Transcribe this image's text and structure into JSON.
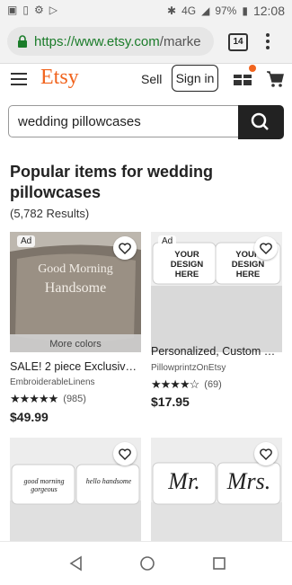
{
  "status": {
    "time": "12:08",
    "battery": "97%",
    "network": "4G"
  },
  "browser": {
    "url_secure": "https://",
    "url_host": "www.etsy.com",
    "url_rest": "/marke",
    "tab_count": "14"
  },
  "header": {
    "logo": "Etsy",
    "sell": "Sell",
    "sign_in": "Sign in"
  },
  "search": {
    "query": "wedding pillowcases"
  },
  "results": {
    "title": "Popular items for wedding pillowcases",
    "count": "(5,782 Results)"
  },
  "products": [
    {
      "ad": "Ad",
      "image_text_1": "Good Morning",
      "image_text_2": "Handsome",
      "more_colors": "More colors",
      "title": "SALE! 2 piece Exclusive ...",
      "shop": "EmbroiderableLinens",
      "rating": 5,
      "reviews": "(985)",
      "price": "$49.99"
    },
    {
      "ad": "Ad",
      "image_text_1": "YOUR DESIGN HERE",
      "image_text_2": "YOUR DESIGN HERE",
      "title": "Personalized, Custom Pr...",
      "shop": "PillowprintzOnEtsy",
      "rating": 4.5,
      "reviews": "(69)",
      "price": "$17.95"
    },
    {
      "image_text_1": "good morning gorgeous",
      "image_text_2": "hello handsome"
    },
    {
      "image_text_1": "Mr.",
      "image_text_2": "Mrs."
    }
  ],
  "colors": {
    "brand": "#f1641e",
    "url_green": "#1b7c2a"
  },
  "icons": [
    "lock-icon",
    "menu-icon",
    "cart-icon",
    "gift-icon",
    "search-icon",
    "heart-icon",
    "back-icon",
    "home-icon",
    "recents-icon"
  ]
}
